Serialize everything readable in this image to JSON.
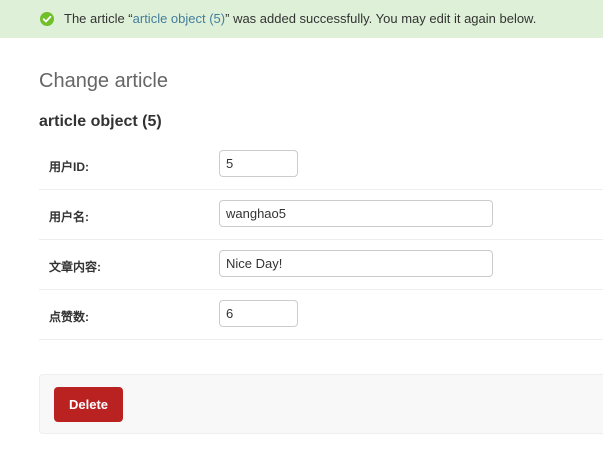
{
  "message": {
    "prefix": "The article “",
    "link_text": "article object (5)",
    "suffix": "” was added successfully. You may edit it again below.",
    "icon": "success-check-icon",
    "background": "#dff0d8",
    "icon_color": "#70bf2b"
  },
  "page": {
    "title": "Change article",
    "object_title": "article object (5)"
  },
  "fields": [
    {
      "label": "用户ID:",
      "value": "5"
    },
    {
      "label": "用户名:",
      "value": "wanghao5"
    },
    {
      "label": "文章内容:",
      "value": "Nice Day!"
    },
    {
      "label": "点赞数:",
      "value": "6"
    }
  ],
  "actions": {
    "delete_label": "Delete",
    "delete_color": "#ba2121"
  }
}
